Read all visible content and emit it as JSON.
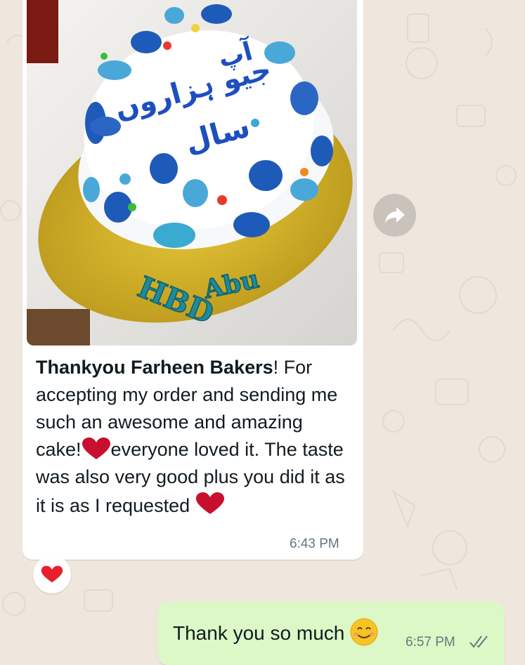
{
  "incoming": {
    "caption_bold": "Thankyou Farheen Bakers",
    "caption_rest": "! For accepting my order and sending me such an awesome and amazing cake!",
    "caption_after_heart": "everyone loved it. The taste was also very good plus you did it as it is as I requested",
    "time": "6:43 PM",
    "reaction_icon": "red-heart-icon",
    "cake_board_text": {
      "left": "HBD",
      "right": "Abu"
    },
    "cake_top_text": "آپ جیو ہزاروں سال"
  },
  "outgoing": {
    "text": "Thank you so much",
    "emoji": "smiling-face-icon",
    "time": "6:57 PM",
    "status": "read"
  },
  "colors": {
    "wallpaper": "#efe7de",
    "incoming_bubble": "#ffffff",
    "outgoing_bubble": "#dcf8c6",
    "read_ticks": "#667781",
    "heart": "#c8102e"
  }
}
